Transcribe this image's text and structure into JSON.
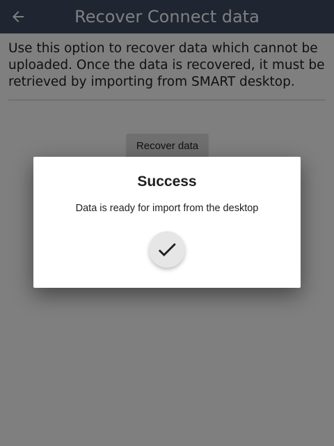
{
  "appbar": {
    "title": "Recover Connect data",
    "background_color": "#3f4b63",
    "back_icon": "arrow-left-icon"
  },
  "main": {
    "description": "Use this option to recover data which cannot be uploaded. Once the data is recovered, it must be retrieved by importing from SMART desktop.",
    "recover_button_label": "Recover data"
  },
  "dialog": {
    "title": "Success",
    "message": "Data is ready for import from the desktop",
    "confirm_icon": "checkmark-icon"
  }
}
